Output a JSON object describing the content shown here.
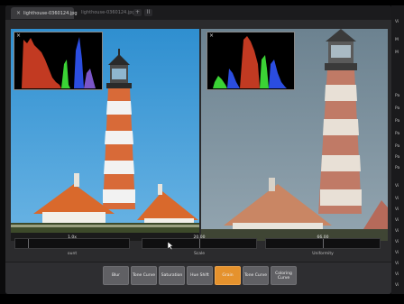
{
  "tabs": [
    {
      "label": "lighthouse-0360124.jpg",
      "active": true
    },
    {
      "label": "lighthouse-0360124.jpg",
      "active": false
    }
  ],
  "tab_buttons": [
    "+",
    "II"
  ],
  "histogram_close": "×",
  "sliders": [
    {
      "value": "1.0x",
      "label": "ount",
      "level": 0.12
    },
    {
      "value": "20.00",
      "label": "Scale",
      "level": 0.5
    },
    {
      "value": "66.00",
      "label": "Uniformity",
      "level": 0.5
    }
  ],
  "toolbar": {
    "buttons": [
      "Blur",
      "Tone Curve",
      "Saturation",
      "Hue Shift",
      "Grain",
      "Tone Curve",
      "Coloring Curve"
    ],
    "active_index": 4
  },
  "right_panel": {
    "items": [
      "Vi",
      "M",
      "M",
      "Pa",
      "Pa",
      "Pa",
      "Pa",
      "Pa",
      "Pa",
      "Pa",
      "Vi",
      "Vi",
      "Vi",
      "Vi",
      "Vi",
      "Vi",
      "Vi",
      "Vi",
      "Vi",
      "Vi"
    ]
  },
  "colors": {
    "accent": "#e5922d",
    "histogram_red": "#c23a22",
    "histogram_green": "#3bd335",
    "histogram_blue": "#2b4de0"
  }
}
